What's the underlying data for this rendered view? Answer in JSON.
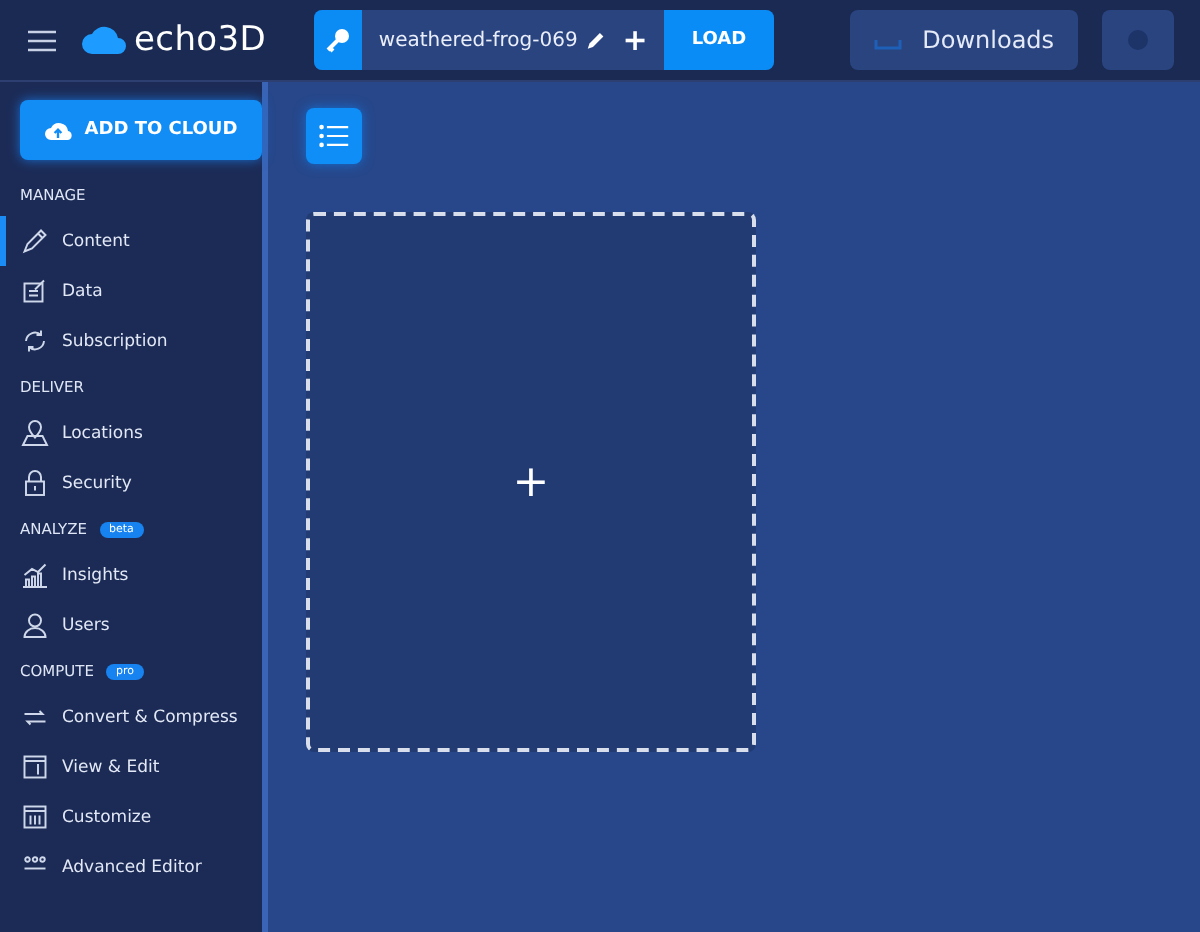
{
  "header": {
    "app_name": "echo3D",
    "api_key": "weathered-frog-069",
    "load_button": "LOAD",
    "plus": "+",
    "downloads_button": "Downloads"
  },
  "sidebar": {
    "add_button": "ADD TO CLOUD",
    "sections": [
      {
        "title": "MANAGE",
        "items": [
          {
            "label": "Content",
            "selected": true
          },
          {
            "label": "Data",
            "selected": false
          },
          {
            "label": "Subscription",
            "selected": false
          }
        ]
      },
      {
        "title": "DELIVER",
        "items": [
          {
            "label": "Locations",
            "selected": false
          },
          {
            "label": "Security",
            "selected": false
          }
        ]
      },
      {
        "title": "ANALYZE",
        "badge": "beta",
        "items": [
          {
            "label": "Insights",
            "selected": false
          },
          {
            "label": "Users",
            "selected": false
          }
        ]
      },
      {
        "title": "COMPUTE",
        "badge": "pro",
        "items": [
          {
            "label": "Convert & Compress",
            "selected": false
          },
          {
            "label": "View & Edit",
            "selected": false
          },
          {
            "label": "Customize",
            "selected": false
          },
          {
            "label": "Advanced Editor",
            "selected": false
          }
        ]
      }
    ]
  },
  "main": {
    "dropzone": {
      "plus": "+"
    }
  }
}
